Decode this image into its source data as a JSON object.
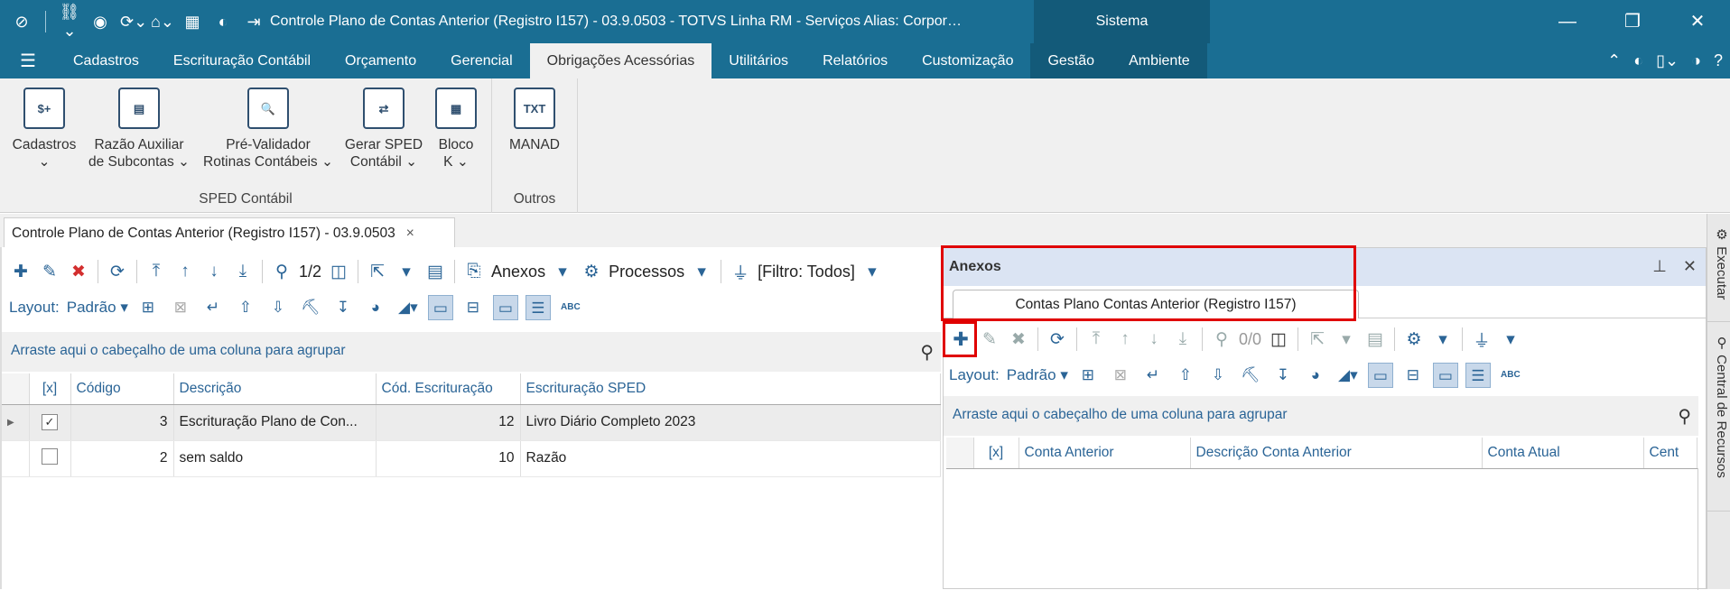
{
  "titlebar": {
    "title": "Controle Plano de Contas Anterior (Registro I157) - 03.9.0503 - TOTVS Linha RM - Serviços  Alias: Corpor…",
    "sistema": "Sistema",
    "icons": [
      "totvs-logo-icon",
      "org-chart-icon",
      "eye-icon",
      "refresh-window-icon",
      "home-icon",
      "calculator-icon",
      "globe-icon",
      "exit-icon"
    ]
  },
  "menu": {
    "items": [
      "Cadastros",
      "Escrituração Contábil",
      "Orçamento",
      "Gerencial",
      "Obrigações Acessórias",
      "Utilitários",
      "Relatórios",
      "Customização",
      "Gestão",
      "Ambiente"
    ],
    "active_index": 4
  },
  "ribbon": {
    "groups": [
      {
        "label": "SPED Contábil",
        "buttons": [
          {
            "label1": "Cadastros",
            "label2": "⌄",
            "icon": "$+"
          },
          {
            "label1": "Razão Auxiliar",
            "label2": "de Subcontas ⌄",
            "icon": "▤"
          },
          {
            "label1": "Pré-Validador",
            "label2": "Rotinas Contábeis ⌄",
            "icon": "🔍"
          },
          {
            "label1": "Gerar SPED",
            "label2": "Contábil ⌄",
            "icon": "⇄"
          },
          {
            "label1": "Bloco",
            "label2": "K ⌄",
            "icon": "▦"
          }
        ]
      },
      {
        "label": "Outros",
        "buttons": [
          {
            "label1": "MANAD",
            "label2": "",
            "icon": "TXT"
          }
        ]
      }
    ]
  },
  "doc_tab": {
    "label": "Controle Plano de Contas Anterior (Registro I157) - 03.9.0503",
    "close": "×"
  },
  "left": {
    "toolbar": {
      "record_pos": "1/2",
      "anexos": "Anexos",
      "processos": "Processos",
      "filtro": "[Filtro: Todos]"
    },
    "layout": {
      "label": "Layout:",
      "value": "Padrão"
    },
    "group_hint": "Arraste aqui o cabeçalho de uma coluna para agrupar",
    "columns": [
      "[x]",
      "Código",
      "Descrição",
      "Cód. Escrituração",
      "Escrituração SPED"
    ],
    "rows": [
      {
        "checked": true,
        "codigo": "3",
        "descricao": "Escrituração Plano de Con...",
        "cod_escrituracao": "12",
        "escrituracao_sped": "Livro Diário Completo 2023"
      },
      {
        "checked": false,
        "codigo": "2",
        "descricao": "sem saldo",
        "cod_escrituracao": "10",
        "escrituracao_sped": "Razão"
      }
    ]
  },
  "right": {
    "header": "Anexos",
    "tab": "Contas Plano Contas Anterior (Registro I157)",
    "toolbar": {
      "record_pos": "0/0"
    },
    "layout": {
      "label": "Layout:",
      "value": "Padrão"
    },
    "group_hint": "Arraste aqui o cabeçalho de uma coluna para agrupar",
    "columns": [
      "[x]",
      "Conta Anterior",
      "Descrição Conta Anterior",
      "Conta Atual",
      "Cent"
    ]
  },
  "sidebar": {
    "items": [
      "Executar",
      "Central de Recursos"
    ]
  },
  "colors": {
    "titlebar": "#1a6e93",
    "highlight": "#e00000",
    "accent": "#2a6496"
  }
}
